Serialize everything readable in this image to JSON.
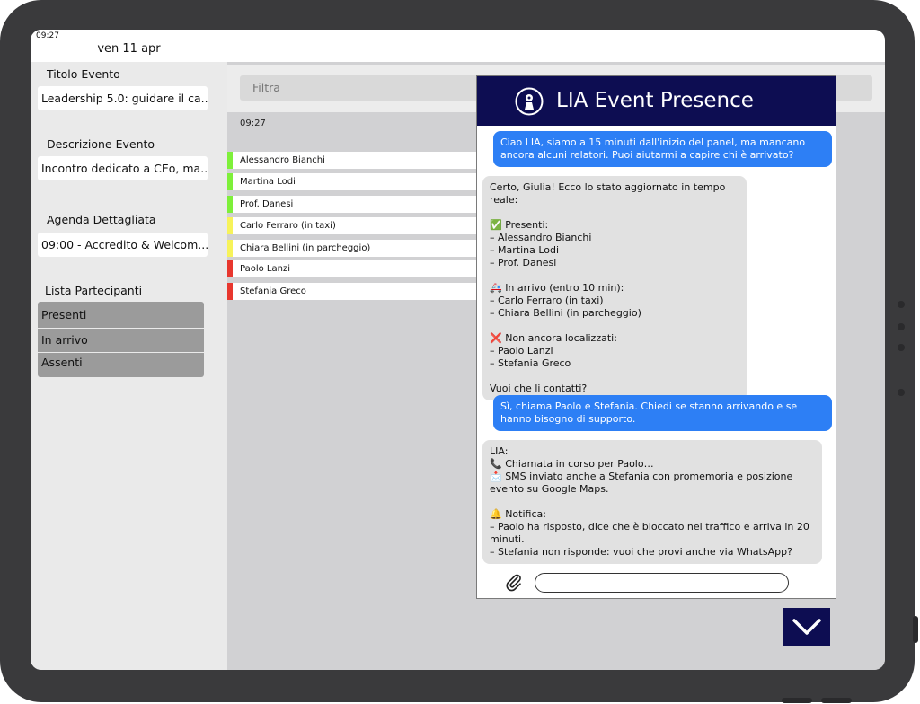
{
  "status": {
    "time": "09:27",
    "date": "ven 11 apr"
  },
  "sidebar": {
    "title_label": "Titolo Evento",
    "title_value": "Leadership 5.0: guidare il ca...",
    "desc_label": "Descrizione Evento",
    "desc_value": "Incontro dedicato a CEo, ma...",
    "agenda_label": "Agenda Dettagliata",
    "agenda_value": "09:00 - Accredito & Welcom...",
    "participants_label": "Lista Partecipanti",
    "participant_buttons": [
      "Presenti",
      "In arrivo",
      "Assenti"
    ]
  },
  "main": {
    "filter_placeholder": "Filtra",
    "time": "09:27",
    "participants": [
      {
        "name": "Alessandro Bianchi",
        "status_color": "#7ef03a"
      },
      {
        "name": "Martina Lodi",
        "status_color": "#7ef03a"
      },
      {
        "name": "Prof. Danesi",
        "status_color": "#7ef03a"
      },
      {
        "name": "Carlo Ferraro (in taxi)",
        "status_color": "#f7f35a"
      },
      {
        "name": "Chiara Bellini (in parcheggio)",
        "status_color": "#f7f35a"
      },
      {
        "name": "Paolo Lanzi",
        "status_color": "#e8372e"
      },
      {
        "name": "Stefania Greco",
        "status_color": "#e8372e"
      }
    ]
  },
  "chat": {
    "title": "LIA Event Presence",
    "messages": [
      {
        "role": "user",
        "text": "Ciao LIA, siamo a 15 minuti dall'inizio del panel, ma mancano ancora alcuni relatori. Puoi aiutarmi a capire chi è arrivato?"
      },
      {
        "role": "bot",
        "text": "Certo, Giulia! Ecco lo stato aggiornato in tempo reale:\n\n✅ Presenti:\n– Alessandro Bianchi\n– Martina Lodi\n– Prof. Danesi\n\n🚑 In arrivo (entro 10 min):\n– Carlo Ferraro (in taxi)\n– Chiara Bellini (in parcheggio)\n\n❌ Non ancora localizzati:\n– Paolo Lanzi\n– Stefania Greco\n\nVuoi che li contatti?"
      },
      {
        "role": "user",
        "text": "Sì, chiama Paolo e Stefania. Chiedi se stanno arrivando e se hanno bisogno di supporto."
      },
      {
        "role": "bot",
        "text": "LIA:\n📞 Chiamata in corso per Paolo…\n📩 SMS inviato anche a Stefania con promemoria e posizione evento su Google Maps.\n\n🔔 Notifica:\n– Paolo ha risposto, dice che è bloccato nel traffico e arriva in 20 minuti.\n– Stefania non risponde: vuoi che provi anche via WhatsApp?"
      }
    ],
    "input_value": ""
  },
  "colors": {
    "header_navy": "#0d0d52",
    "user_bubble": "#2d7ff5",
    "bot_bubble": "#e1e1e1"
  },
  "icons": [
    "lia-logo-icon",
    "paperclip-icon",
    "chevron-down-icon"
  ]
}
